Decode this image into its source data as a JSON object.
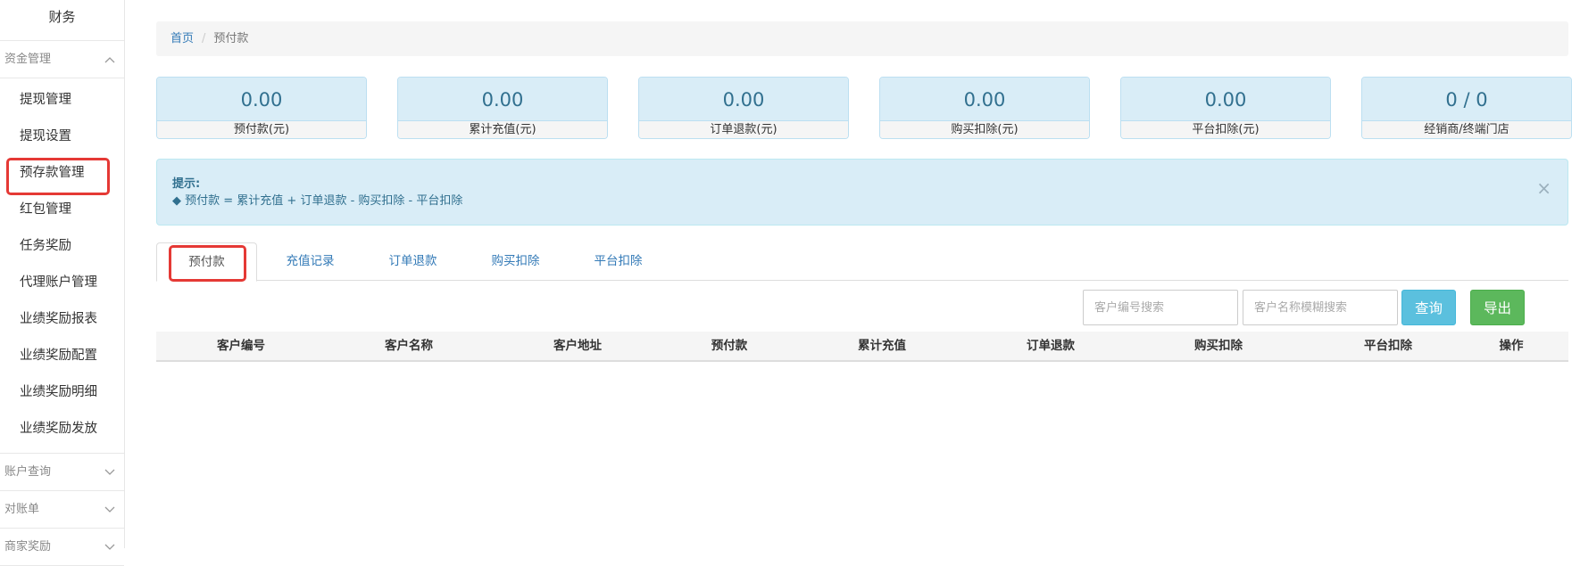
{
  "sidebar": {
    "title": "财务",
    "groups": [
      {
        "label": "资金管理",
        "expanded": true,
        "items": [
          {
            "label": "提现管理"
          },
          {
            "label": "提现设置"
          },
          {
            "label": "预存款管理",
            "active": true
          },
          {
            "label": "红包管理"
          },
          {
            "label": "任务奖励"
          },
          {
            "label": "代理账户管理"
          },
          {
            "label": "业绩奖励报表"
          },
          {
            "label": "业绩奖励配置"
          },
          {
            "label": "业绩奖励明细"
          },
          {
            "label": "业绩奖励发放"
          }
        ]
      },
      {
        "label": "账户查询",
        "expanded": false
      },
      {
        "label": "对账单",
        "expanded": false
      },
      {
        "label": "商家奖励",
        "expanded": false
      }
    ]
  },
  "breadcrumb": {
    "home": "首页",
    "separator": "/",
    "current": "预付款"
  },
  "stats": [
    {
      "value": "0.00",
      "label": "预付款(元)"
    },
    {
      "value": "0.00",
      "label": "累计充值(元)"
    },
    {
      "value": "0.00",
      "label": "订单退款(元)"
    },
    {
      "value": "0.00",
      "label": "购买扣除(元)"
    },
    {
      "value": "0.00",
      "label": "平台扣除(元)"
    },
    {
      "value": "0 / 0",
      "label": "经销商/终端门店"
    }
  ],
  "alert": {
    "title": "提示:",
    "text": "◆ 预付款 = 累计充值 + 订单退款 - 购买扣除 - 平台扣除",
    "close": "×"
  },
  "tabs": [
    {
      "label": "预付款",
      "active": true
    },
    {
      "label": "充值记录"
    },
    {
      "label": "订单退款"
    },
    {
      "label": "购买扣除"
    },
    {
      "label": "平台扣除"
    }
  ],
  "search": {
    "customer_no_placeholder": "客户编号搜索",
    "customer_name_placeholder": "客户名称模糊搜索",
    "query_label": "查询",
    "export_label": "导出"
  },
  "table": {
    "columns": [
      "客户编号",
      "客户名称",
      "客户地址",
      "预付款",
      "累计充值",
      "订单退款",
      "购买扣除",
      "平台扣除",
      "操作"
    ],
    "rows": []
  },
  "colors": {
    "link": "#337ab7",
    "info_bg": "#d9edf7",
    "info_text": "#31708f",
    "query_button": "#5bc0de",
    "export_button": "#5cb85c",
    "highlight": "#e53935"
  }
}
